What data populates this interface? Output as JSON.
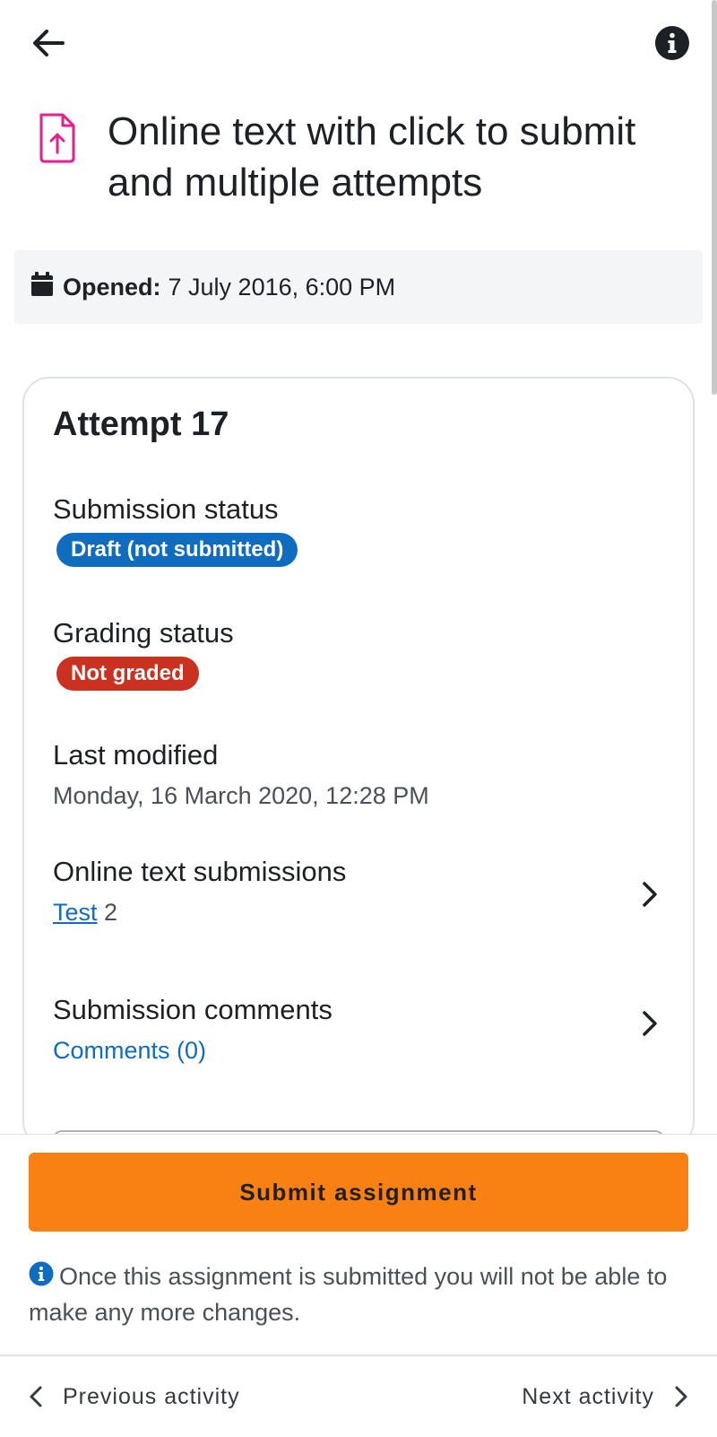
{
  "header": {
    "back_icon": "arrow-left-icon",
    "info_icon": "info-circle-icon"
  },
  "title": {
    "icon": "assignment-upload-icon",
    "text": "Online text with click to submit and multiple attempts",
    "icon_color": "#e91e8c"
  },
  "opened": {
    "icon": "calendar-icon",
    "label": "Opened:",
    "value": "7 July 2016, 6:00 PM"
  },
  "card": {
    "title": "Attempt 17",
    "submission_status": {
      "label": "Submission status",
      "badge": "Draft (not submitted)",
      "badge_color": "#0f6cbf"
    },
    "grading_status": {
      "label": "Grading status",
      "badge": "Not graded",
      "badge_color": "#ca3120"
    },
    "last_modified": {
      "label": "Last modified",
      "value": "Monday, 16 March 2020, 12:28 PM"
    },
    "online_text": {
      "label": "Online text submissions",
      "link": "Test",
      "suffix": "2"
    },
    "comments": {
      "label": "Submission comments",
      "link": "Comments (0)"
    }
  },
  "actions": {
    "submit_label": "Submit assignment",
    "submit_color": "#f98012",
    "notice": "Once this assignment is submitted you will not be able to make any more changes."
  },
  "nav": {
    "previous": "Previous activity",
    "next": "Next activity"
  }
}
